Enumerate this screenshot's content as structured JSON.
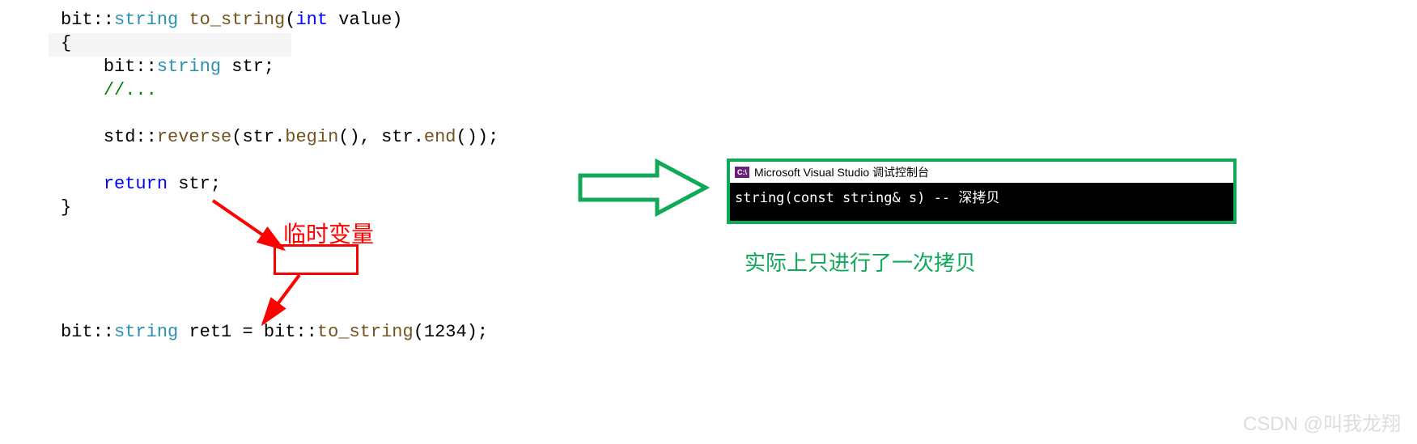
{
  "code": {
    "ns": "bit",
    "type_string": "string",
    "func_to_string": "to_string",
    "kw_int": "int",
    "param": "value",
    "var_str": "str",
    "comment": "//...",
    "std": "std",
    "reverse": "reverse",
    "begin": "begin",
    "end": "end",
    "kw_return": "return",
    "ret_var": "ret1",
    "call_arg": "1234"
  },
  "annotations": {
    "temp_var_label": "临时变量",
    "green_caption": "实际上只进行了一次拷贝"
  },
  "console": {
    "icon_text": "C:\\",
    "title": "Microsoft Visual Studio 调试控制台",
    "output": "string(const string& s) -- 深拷贝"
  },
  "watermark": "CSDN @叫我龙翔"
}
